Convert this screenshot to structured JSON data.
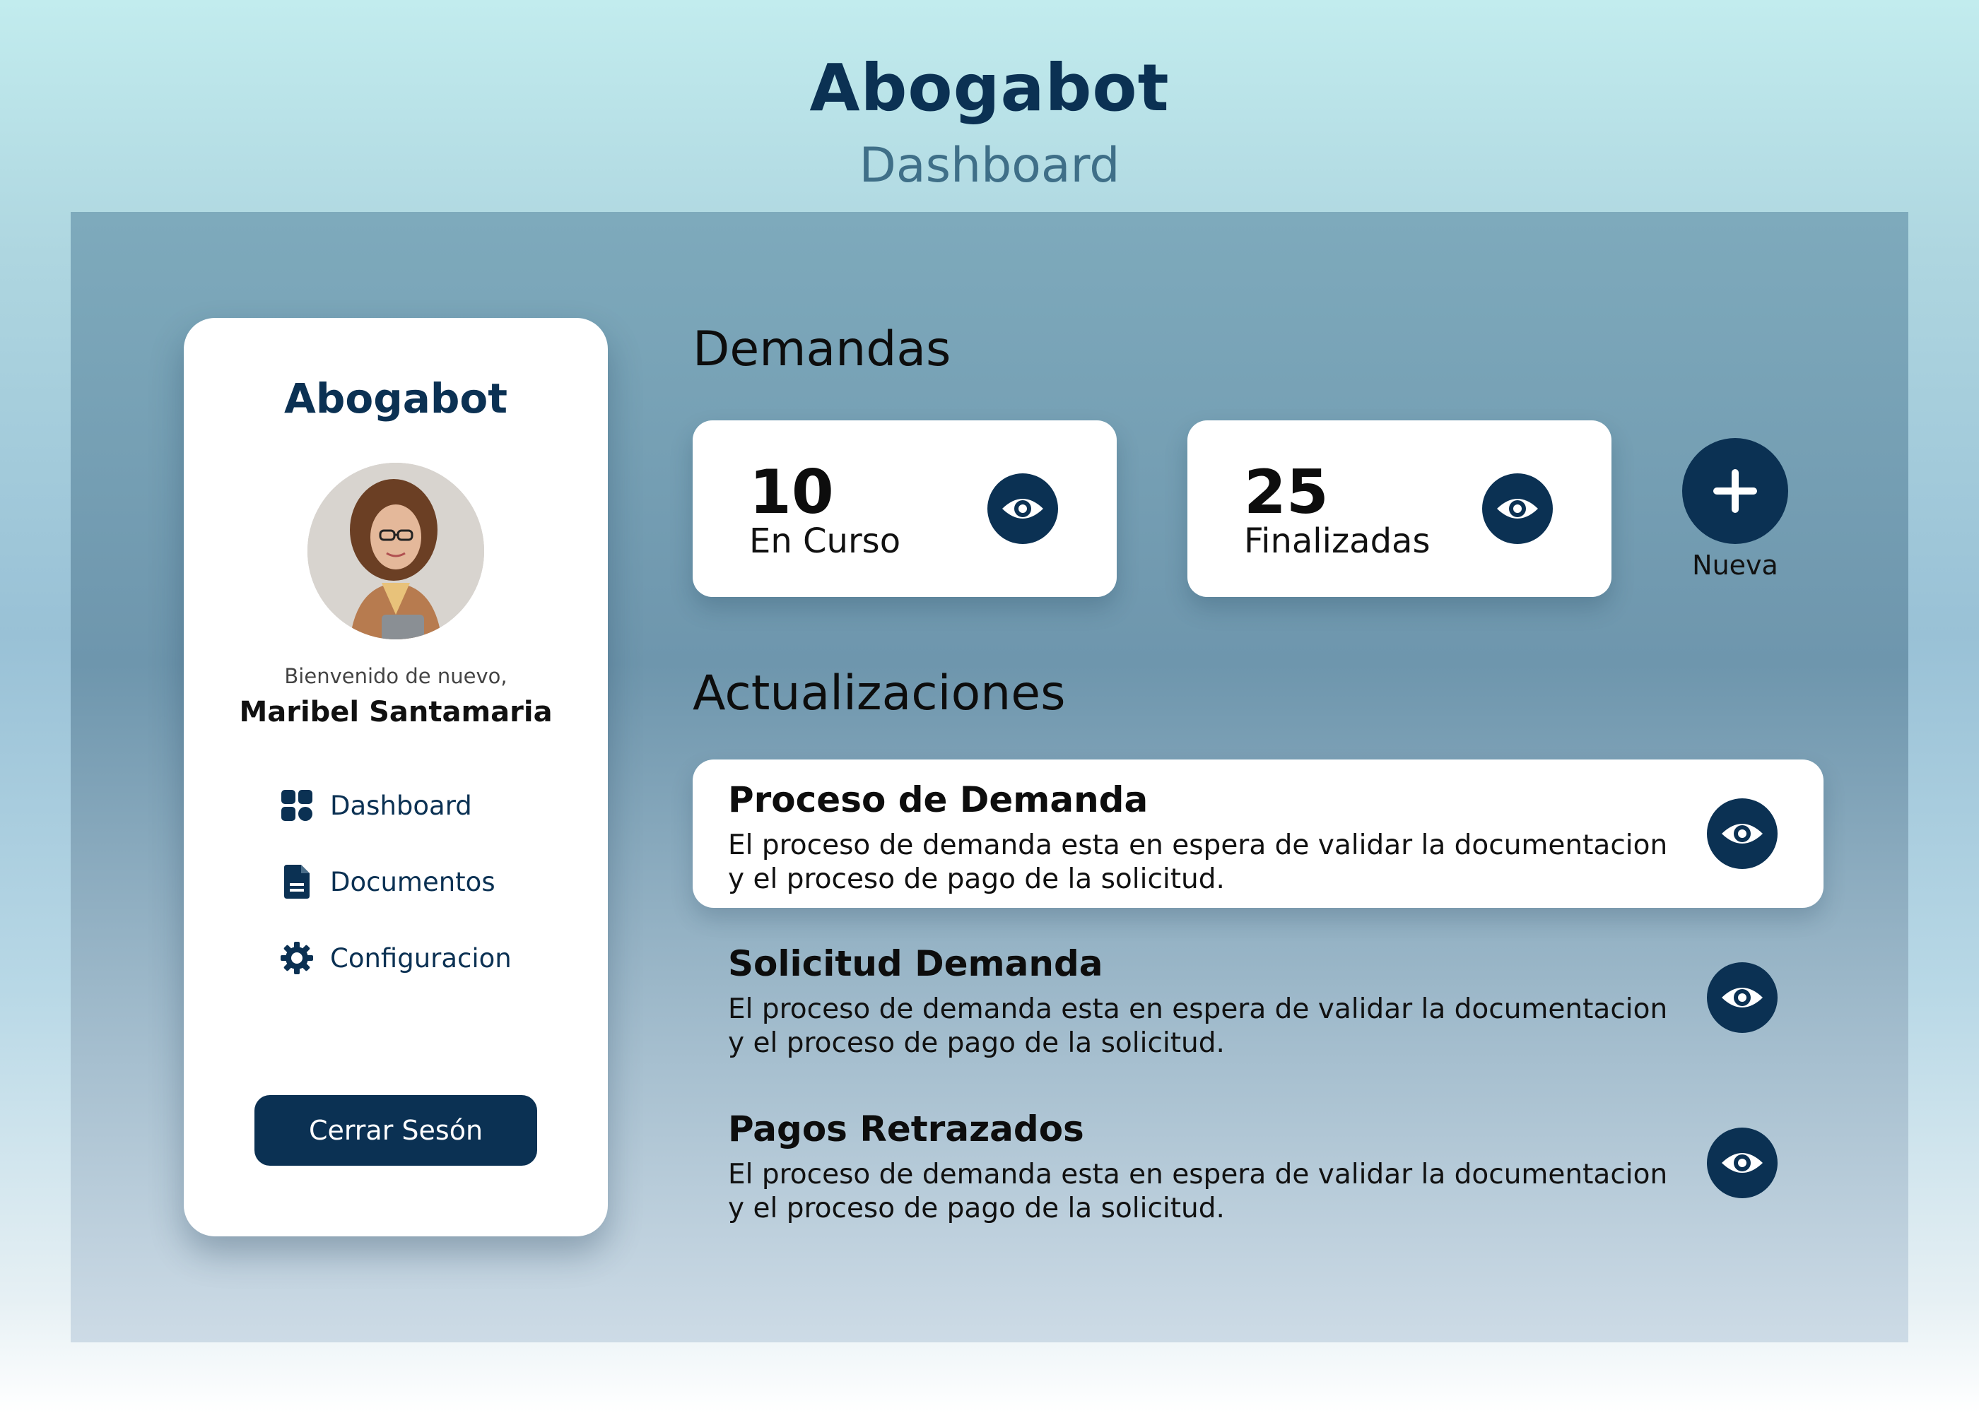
{
  "header": {
    "app_title": "Abogabot",
    "subtitle": "Dashboard"
  },
  "sidebar": {
    "brand": "Abogabot",
    "welcome": "Bienvenido de nuevo,",
    "user_name": "Maribel Santamaria",
    "nav": [
      {
        "label": "Dashboard",
        "icon": "dashboard-grid-icon"
      },
      {
        "label": "Documentos",
        "icon": "document-icon"
      },
      {
        "label": "Configuracion",
        "icon": "gear-icon"
      }
    ],
    "logout_label": "Cerrar Sesón"
  },
  "demandas": {
    "title": "Demandas",
    "cards": [
      {
        "value": "10",
        "label": "En Curso",
        "icon": "eye-icon"
      },
      {
        "value": "25",
        "label": "Finalizadas",
        "icon": "eye-icon"
      }
    ],
    "new_label": "Nueva",
    "new_icon": "plus-icon"
  },
  "actualizaciones": {
    "title": "Actualizaciones",
    "items": [
      {
        "title": "Proceso de Demanda",
        "description": "El proceso de demanda esta en espera de validar la documentacion y el proceso de pago de la solicitud."
      },
      {
        "title": "Solicitud Demanda",
        "description": "El proceso de demanda esta en espera de validar la documentacion y el proceso de pago de la solicitud."
      },
      {
        "title": "Pagos Retrazados",
        "description": "El proceso de demanda esta en espera de validar la documentacion y el proceso de pago de la solicitud."
      }
    ]
  },
  "colors": {
    "primary": "#0b3153",
    "subtitle": "#3f6f88",
    "card_bg": "#ffffff"
  }
}
